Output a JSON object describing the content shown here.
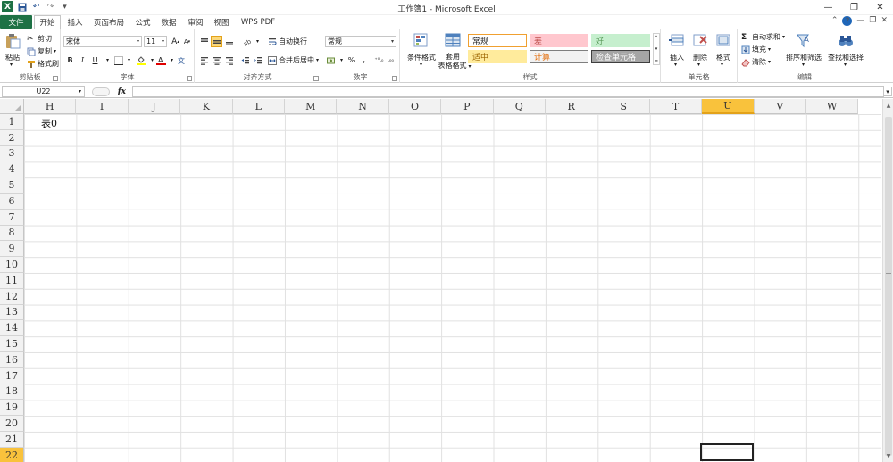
{
  "window": {
    "title": "工作簿1 - Microsoft Excel",
    "min_glyph": "—",
    "restore_glyph": "❐",
    "close_glyph": "✕"
  },
  "qat": {
    "save_glyph": "💾",
    "undo_glyph": "↶",
    "redo_glyph": "↷",
    "customize_glyph": "▾"
  },
  "tabs": {
    "file": "文件",
    "home": "开始",
    "insert": "插入",
    "layout": "页面布局",
    "formulas": "公式",
    "data": "数据",
    "review": "审阅",
    "view": "视图",
    "wpspdf": "WPS PDF"
  },
  "ribbon": {
    "clipboard": {
      "label": "剪贴板",
      "paste": "粘贴",
      "cut": "剪切",
      "copy": "复制",
      "format_painter": "格式刷"
    },
    "font": {
      "label": "字体",
      "name": "宋体",
      "size": "11",
      "bold": "B",
      "italic": "I",
      "underline": "U",
      "grow": "A",
      "shrink": "A"
    },
    "alignment": {
      "label": "对齐方式",
      "wrap": "自动换行",
      "merge": "合并后居中"
    },
    "number": {
      "label": "数字",
      "format": "常规",
      "percent": "%",
      "comma": ","
    },
    "styles": {
      "label": "样式",
      "conditional": "条件格式",
      "table_line1": "套用",
      "table_line2": "表格格式",
      "cells": [
        {
          "text": "常规",
          "bg": "#ffffff",
          "fg": "#222222",
          "border": "#f0a030"
        },
        {
          "text": "差",
          "bg": "#ffc7ce",
          "fg": "#c0504d",
          "border": "#ffc7ce"
        },
        {
          "text": "好",
          "bg": "#c6efce",
          "fg": "#5a9a5a",
          "border": "#c6efce"
        },
        {
          "text": "适中",
          "bg": "#ffeb9c",
          "fg": "#9c6500",
          "border": "#ffeb9c"
        },
        {
          "text": "计算",
          "bg": "#f2f2f2",
          "fg": "#e36c09",
          "border": "#7f7f7f"
        },
        {
          "text": "检查单元格",
          "bg": "#a5a5a5",
          "fg": "#ffffff",
          "border": "#3f3f3f"
        }
      ]
    },
    "cells": {
      "label": "单元格",
      "insert": "插入",
      "delete": "删除",
      "format": "格式"
    },
    "editing": {
      "label": "编辑",
      "autosum": "自动求和",
      "fill": "填充",
      "clear": "清除",
      "sort": "排序和筛选",
      "find": "查找和选择"
    }
  },
  "formula_bar": {
    "name_box": "U22",
    "fx": "fx",
    "value": ""
  },
  "sheet": {
    "columns": [
      "H",
      "I",
      "J",
      "K",
      "L",
      "M",
      "N",
      "O",
      "P",
      "Q",
      "R",
      "S",
      "T",
      "U",
      "V",
      "W"
    ],
    "selected_column": "U",
    "rows": [
      "1",
      "2",
      "3",
      "4",
      "5",
      "6",
      "7",
      "8",
      "9",
      "10",
      "11",
      "12",
      "13",
      "14",
      "15",
      "16",
      "17",
      "18",
      "19",
      "20",
      "21",
      "22"
    ],
    "selected_row": "22",
    "cell_H1": "表0",
    "active_cell": "U22"
  }
}
